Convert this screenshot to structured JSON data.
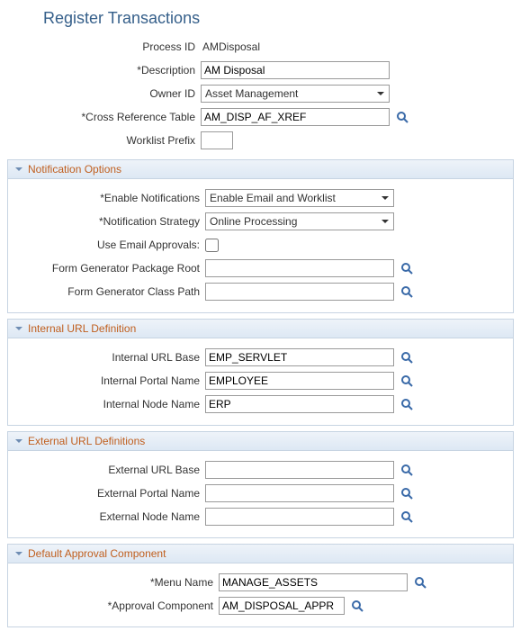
{
  "page_title": "Register Transactions",
  "top": {
    "process_id_label": "Process ID",
    "process_id_value": "AMDisposal",
    "description_label": "*Description",
    "description_value": "AM Disposal",
    "owner_id_label": "Owner ID",
    "owner_id_value": "Asset Management",
    "cross_ref_label": "*Cross Reference Table",
    "cross_ref_value": "AM_DISP_AF_XREF",
    "worklist_prefix_label": "Worklist Prefix",
    "worklist_prefix_value": ""
  },
  "sections": {
    "notif": {
      "title": "Notification Options",
      "enable_label": "*Enable Notifications",
      "enable_value": "Enable Email and Worklist",
      "strategy_label": "*Notification Strategy",
      "strategy_value": "Online Processing",
      "email_approvals_label": "Use Email Approvals:",
      "pkg_root_label": "Form Generator Package Root",
      "pkg_root_value": "",
      "class_path_label": "Form Generator Class Path",
      "class_path_value": ""
    },
    "intUrl": {
      "title": "Internal URL Definition",
      "base_label": "Internal URL Base",
      "base_value": "EMP_SERVLET",
      "portal_label": "Internal Portal Name",
      "portal_value": "EMPLOYEE",
      "node_label": "Internal Node Name",
      "node_value": "ERP"
    },
    "extUrl": {
      "title": "External URL Definitions",
      "base_label": "External URL Base",
      "base_value": "",
      "portal_label": "External Portal Name",
      "portal_value": "",
      "node_label": "External Node Name",
      "node_value": ""
    },
    "defAppr": {
      "title": "Default Approval Component",
      "menu_label": "*Menu Name",
      "menu_value": "MANAGE_ASSETS",
      "comp_label": "*Approval Component",
      "comp_value": "AM_DISPOSAL_APPR"
    }
  }
}
